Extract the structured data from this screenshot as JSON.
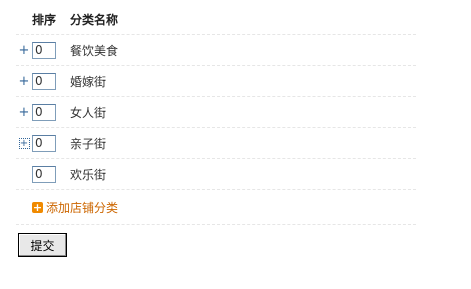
{
  "table": {
    "headers": {
      "order": "排序",
      "name": "分类名称"
    },
    "rows": [
      {
        "toggle": "+",
        "order": "0",
        "name": "餐饮美食",
        "toggle_style": "plain"
      },
      {
        "toggle": "+",
        "order": "0",
        "name": "婚嫁街",
        "toggle_style": "plain"
      },
      {
        "toggle": "+",
        "order": "0",
        "name": "女人街",
        "toggle_style": "plain"
      },
      {
        "toggle": "+",
        "order": "0",
        "name": "亲子街",
        "toggle_style": "focused"
      },
      {
        "toggle": "",
        "order": "0",
        "name": "欢乐街",
        "toggle_style": "none"
      }
    ]
  },
  "add_category": {
    "icon": "+",
    "label": "添加店铺分类"
  },
  "submit": {
    "label": "提交"
  },
  "colors": {
    "link": "#cc6600",
    "toggle": "#336699",
    "add_icon": "#f08a00"
  }
}
